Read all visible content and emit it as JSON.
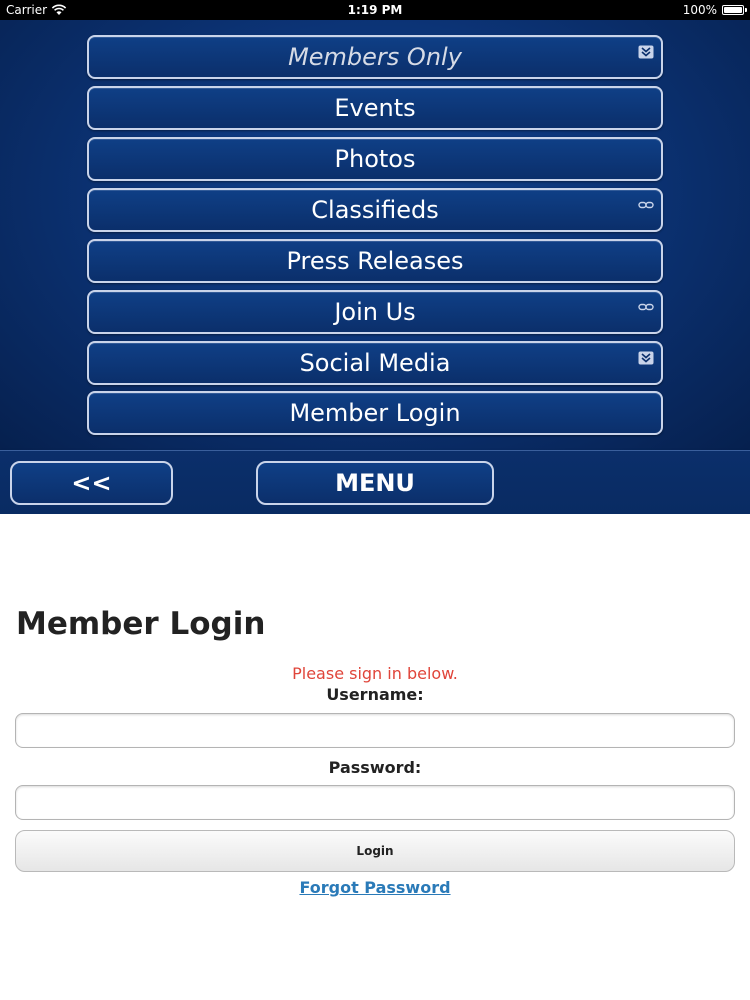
{
  "status_bar": {
    "carrier": "Carrier",
    "time": "1:19 PM",
    "battery": "100%",
    "battery_level": 1.0
  },
  "nav_menu": {
    "items": [
      {
        "label": "Members Only",
        "icon": "chevron-double-down-icon"
      },
      {
        "label": "Events",
        "icon": ""
      },
      {
        "label": "Photos",
        "icon": ""
      },
      {
        "label": "Classifieds",
        "icon": "link-icon"
      },
      {
        "label": "Press Releases",
        "icon": ""
      },
      {
        "label": "Join Us",
        "icon": "link-icon"
      },
      {
        "label": "Social Media",
        "icon": "chevron-double-down-icon"
      },
      {
        "label": "Member Login",
        "icon": ""
      }
    ]
  },
  "toolbar": {
    "back_label": "<<",
    "menu_label": "MENU"
  },
  "login": {
    "title": "Member Login",
    "message": "Please sign in below.",
    "username_label": "Username:",
    "username_value": "",
    "password_label": "Password:",
    "password_value": "",
    "login_button": "Login",
    "forgot_link": "Forgot Password"
  },
  "colors": {
    "nav_background": "#0c3477",
    "nav_border": "#c9d4ea",
    "message_red": "#e0453a",
    "link_blue": "#2a7ab8"
  }
}
